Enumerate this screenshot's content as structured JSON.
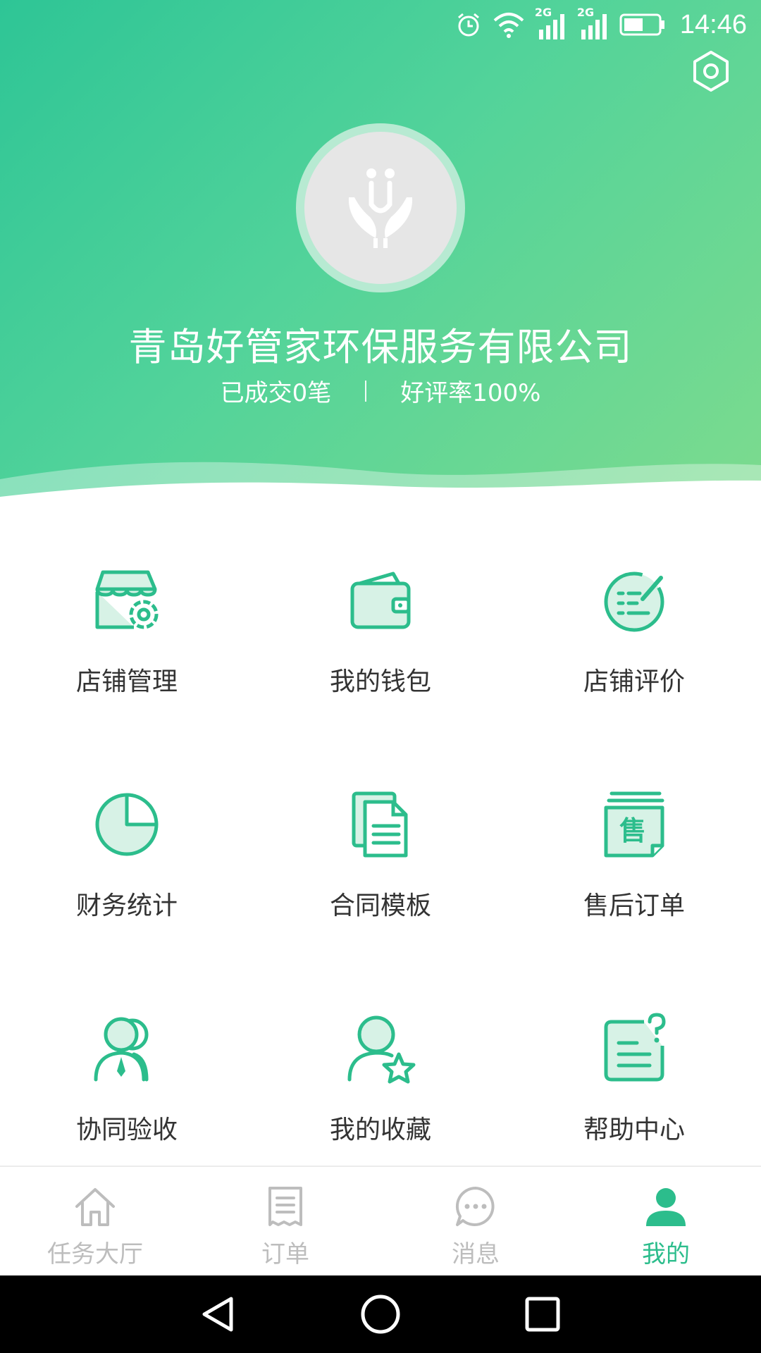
{
  "status_bar": {
    "time": "14:46",
    "network_label_1": "2G",
    "network_label_2": "2G",
    "icons": [
      "alarm-icon",
      "wifi-icon",
      "signal-icon",
      "signal-icon",
      "battery-icon"
    ]
  },
  "profile": {
    "company_name": "青岛好管家环保服务有限公司",
    "deals": "已成交0笔",
    "rating": "好评率100%"
  },
  "menu": [
    {
      "label": "店铺管理",
      "icon": "store-settings-icon"
    },
    {
      "label": "我的钱包",
      "icon": "wallet-icon"
    },
    {
      "label": "店铺评价",
      "icon": "review-icon"
    },
    {
      "label": "财务统计",
      "icon": "pie-chart-icon"
    },
    {
      "label": "合同模板",
      "icon": "document-icon"
    },
    {
      "label": "售后订单",
      "icon": "after-sales-icon"
    },
    {
      "label": "协同验收",
      "icon": "team-icon"
    },
    {
      "label": "我的收藏",
      "icon": "favorite-user-icon"
    },
    {
      "label": "帮助中心",
      "icon": "help-icon"
    }
  ],
  "after_sales_glyph": "售",
  "tabs": [
    {
      "label": "任务大厅",
      "icon": "home-icon",
      "active": false
    },
    {
      "label": "订单",
      "icon": "order-list-icon",
      "active": false
    },
    {
      "label": "消息",
      "icon": "message-icon",
      "active": false
    },
    {
      "label": "我的",
      "icon": "user-icon",
      "active": true
    }
  ],
  "colors": {
    "primary": "#2cbd8c",
    "header_start": "#2ec596",
    "header_end": "#7ddb8e",
    "icon_fill": "#d7f2e6",
    "tab_inactive": "#bdbdbd"
  }
}
